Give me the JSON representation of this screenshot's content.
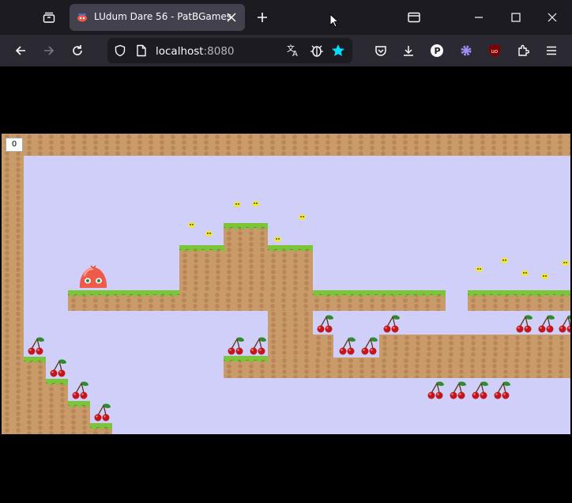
{
  "browser": {
    "tab_title": "LUdum Dare 56 - PatBGames",
    "url_host": "localhost",
    "url_port": ":8080"
  },
  "game": {
    "score": "0"
  },
  "colors": {
    "sky": "#cfcffa",
    "dirt": "#c99a6a",
    "grass": "#7cc43a",
    "slime": "#f05a4a"
  },
  "icons": [
    "tab-groups-icon",
    "favicon-icon",
    "close-tab-icon",
    "new-tab-icon",
    "tab-list-icon",
    "minimize-icon",
    "maximize-icon",
    "close-window-icon",
    "back-icon",
    "forward-icon",
    "reload-icon",
    "shield-icon",
    "page-icon",
    "translate-icon",
    "bug-icon",
    "star-icon",
    "pocket-icon",
    "download-icon",
    "account-p-icon",
    "gear-extension-icon",
    "ublock-icon",
    "extensions-icon",
    "menu-icon"
  ]
}
